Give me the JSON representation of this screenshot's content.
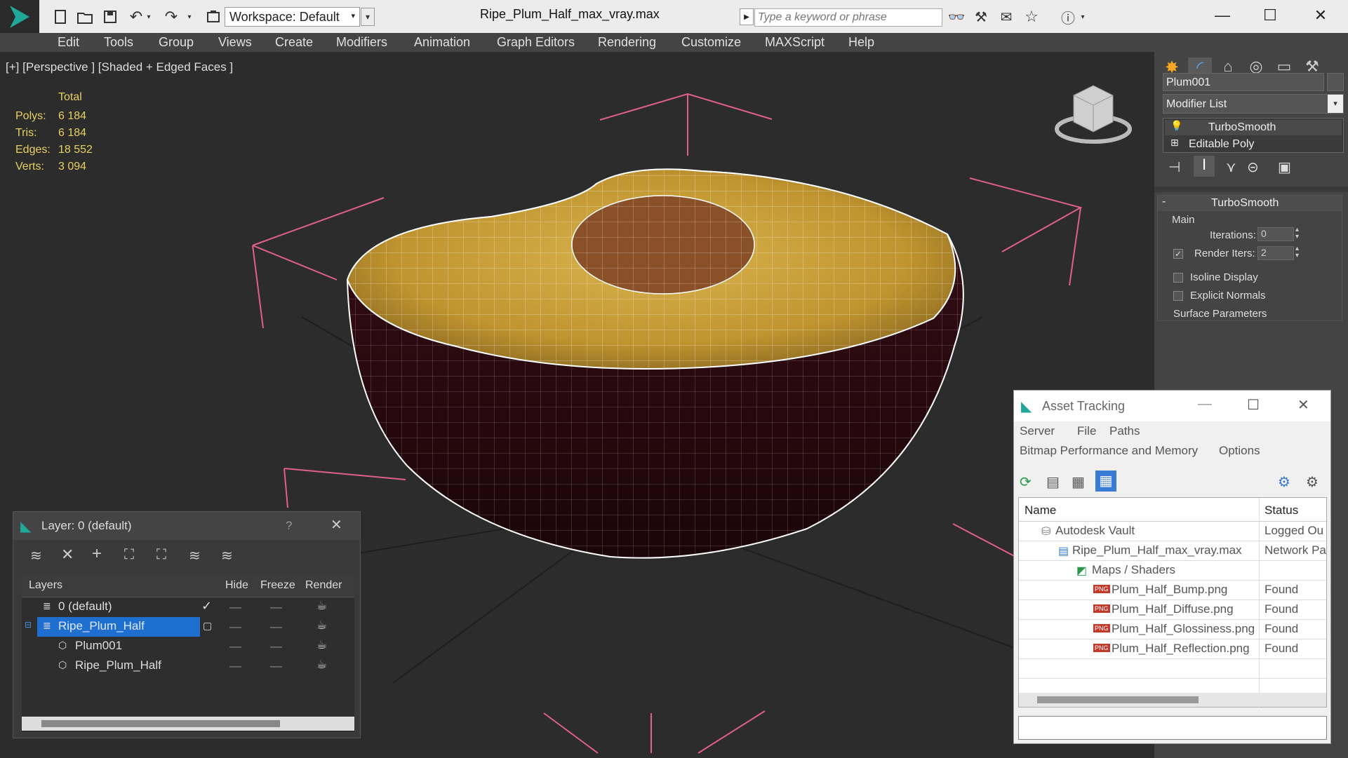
{
  "title": {
    "workspace_label": "Workspace: Default",
    "filename": "Ripe_Plum_Half_max_vray.max",
    "search_placeholder": "Type a keyword or phrase"
  },
  "menu": [
    "Edit",
    "Tools",
    "Group",
    "Views",
    "Create",
    "Modifiers",
    "Animation",
    "Graph Editors",
    "Rendering",
    "Customize",
    "MAXScript",
    "Help"
  ],
  "viewport": {
    "label": "[+] [Perspective ] [Shaded + Edged Faces ]",
    "stats_header": "Total",
    "stats": [
      {
        "label": "Polys:",
        "value": "6 184"
      },
      {
        "label": "Tris:",
        "value": "6 184"
      },
      {
        "label": "Edges:",
        "value": "18 552"
      },
      {
        "label": "Verts:",
        "value": "3 094"
      }
    ]
  },
  "command_panel": {
    "object_name": "Plum001",
    "modifier_list": "Modifier List",
    "stack": [
      "TurboSmooth",
      "Editable Poly"
    ],
    "rollout_title": "TurboSmooth",
    "group_main": "Main",
    "iterations_label": "Iterations:",
    "iterations_value": "0",
    "render_iters_label": "Render Iters:",
    "render_iters_value": "2",
    "isoline_label": "Isoline Display",
    "explicit_normals_label": "Explicit Normals",
    "surface_params": "Surface Parameters"
  },
  "layer_panel": {
    "title": "Layer: 0 (default)",
    "help": "?",
    "columns": [
      "Layers",
      "Hide",
      "Freeze",
      "Render"
    ],
    "rows": [
      {
        "name": "0 (default)",
        "indent": 0,
        "selected": false
      },
      {
        "name": "Ripe_Plum_Half",
        "indent": 0,
        "selected": true
      },
      {
        "name": "Plum001",
        "indent": 1,
        "selected": false
      },
      {
        "name": "Ripe_Plum_Half",
        "indent": 1,
        "selected": false
      }
    ]
  },
  "asset_panel": {
    "title": "Asset Tracking",
    "menus": [
      "Server",
      "File",
      "Paths"
    ],
    "menus2": [
      "Bitmap Performance and Memory",
      "Options"
    ],
    "columns": [
      "Name",
      "Status"
    ],
    "rows": [
      {
        "name": "Autodesk Vault",
        "status": "Logged Ou",
        "indent": 0,
        "icon": "vault"
      },
      {
        "name": "Ripe_Plum_Half_max_vray.max",
        "status": "Network Pa",
        "indent": 1,
        "icon": "max"
      },
      {
        "name": "Maps / Shaders",
        "status": "",
        "indent": 2,
        "icon": "maps"
      },
      {
        "name": "Plum_Half_Bump.png",
        "status": "Found",
        "indent": 3,
        "icon": "png"
      },
      {
        "name": "Plum_Half_Diffuse.png",
        "status": "Found",
        "indent": 3,
        "icon": "png"
      },
      {
        "name": "Plum_Half_Glossiness.png",
        "status": "Found",
        "indent": 3,
        "icon": "png"
      },
      {
        "name": "Plum_Half_Reflection.png",
        "status": "Found",
        "indent": 3,
        "icon": "png"
      }
    ],
    "png_badge": "PNG"
  }
}
